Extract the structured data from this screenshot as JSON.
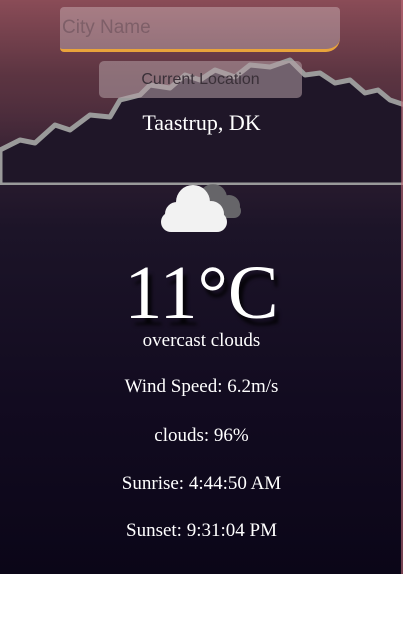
{
  "search": {
    "placeholder": "City Name",
    "value": ""
  },
  "current_location_label": "Current Location",
  "location": "Taastrup, DK",
  "weather_icon": "overcast-clouds-icon",
  "temperature": "11°C",
  "description": "overcast clouds",
  "wind_speed": "Wind Speed: 6.2m/s",
  "clouds": "clouds: 96%",
  "sunrise": "Sunrise: 4:44:50 AM",
  "sunset": "Sunset: 9:31:04 PM",
  "colors": {
    "input_underline": "#e9a33b",
    "text": "#ffffff"
  }
}
